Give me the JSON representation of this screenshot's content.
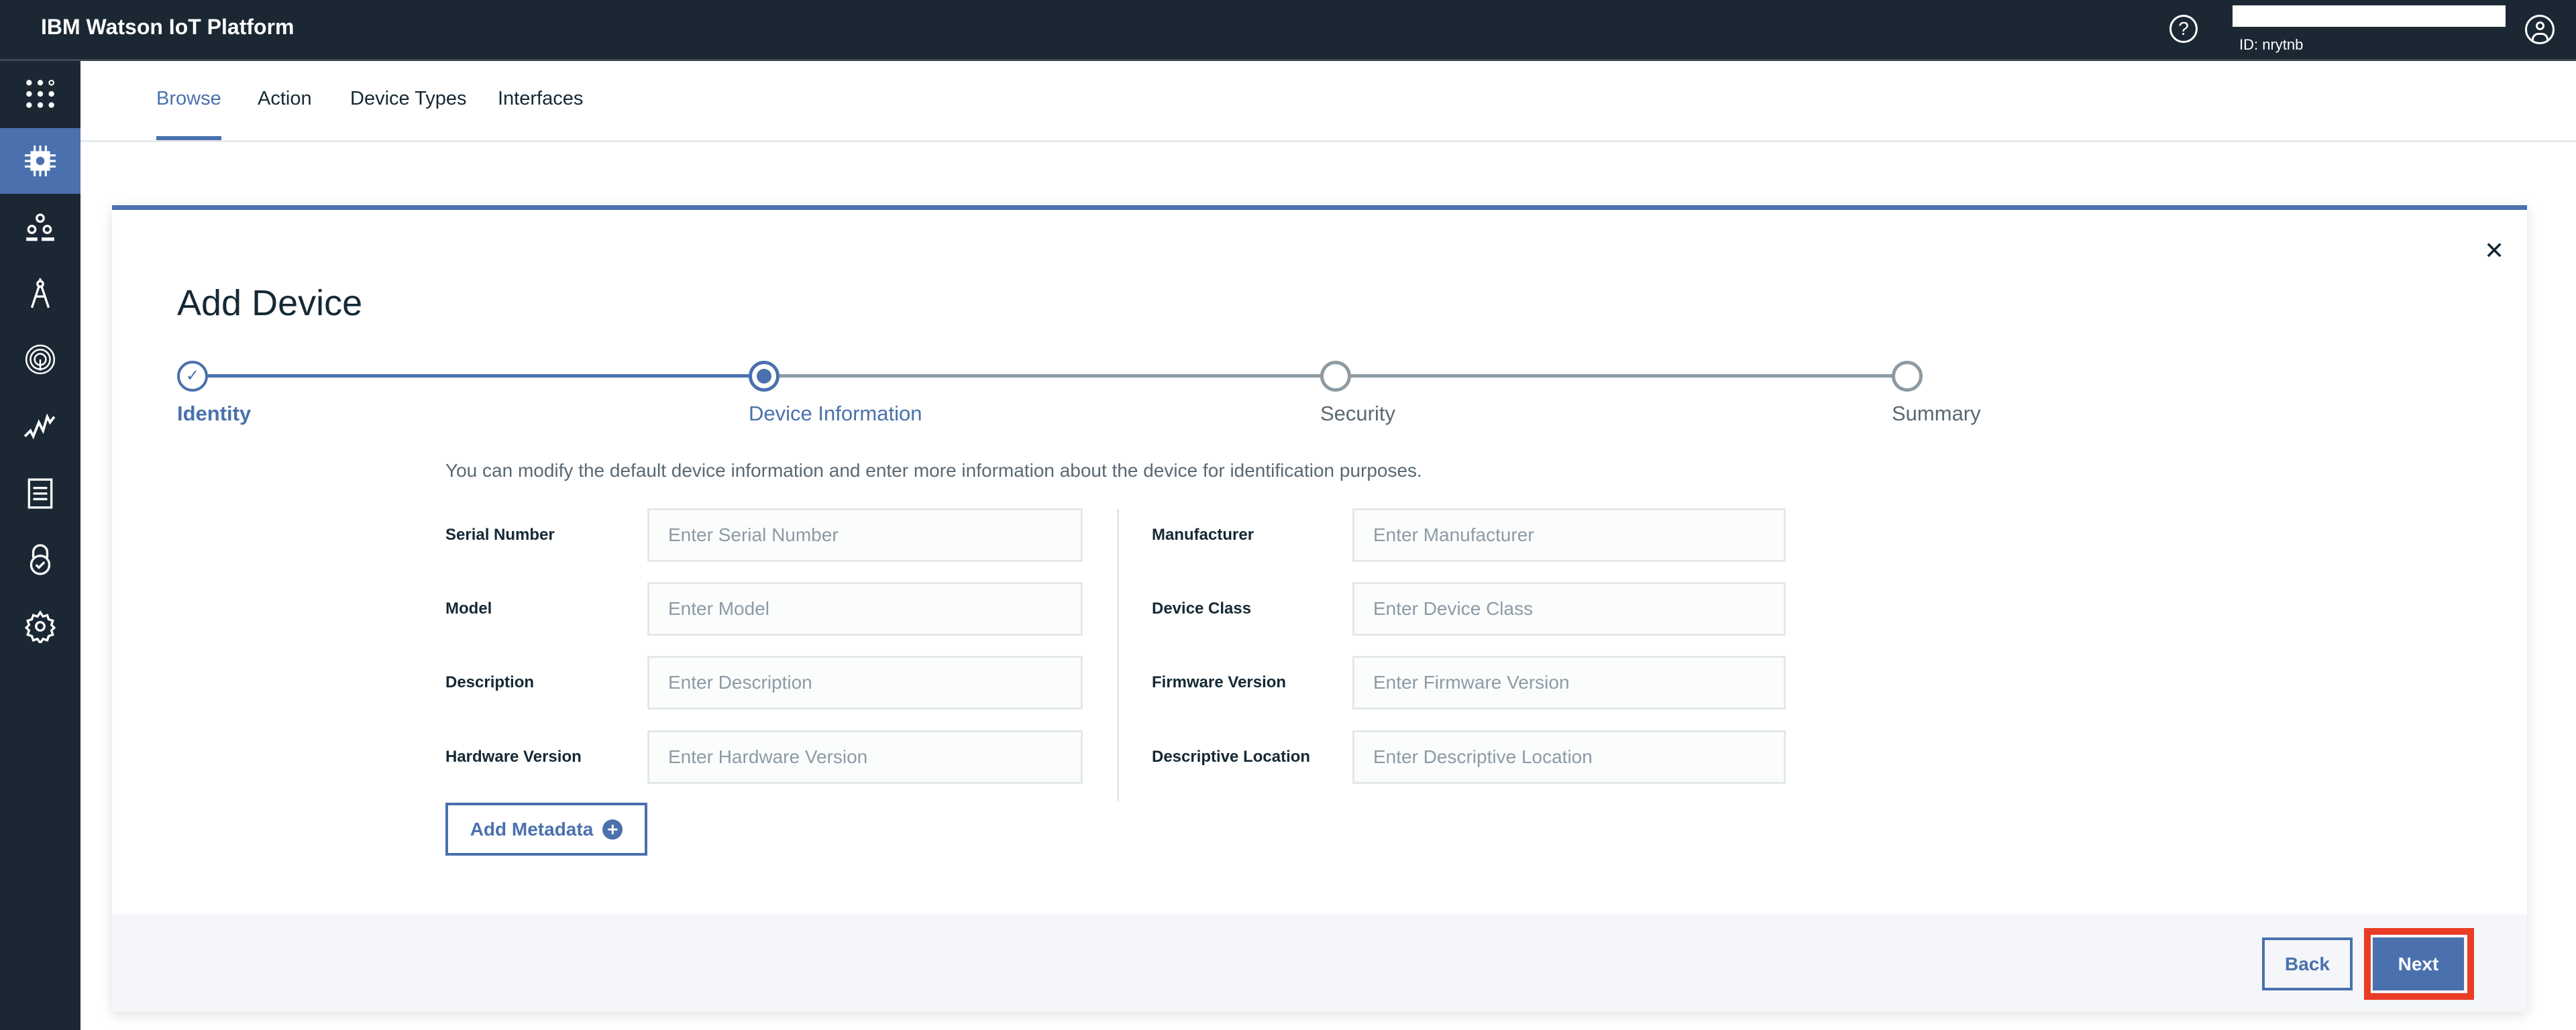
{
  "header": {
    "title": "IBM Watson IoT Platform",
    "org_id": "ID: nrytnb",
    "icons": [
      "help-icon",
      "avatar-icon"
    ]
  },
  "sidebar": {
    "items": [
      {
        "icon": "app-switcher-icon",
        "active": false
      },
      {
        "icon": "chip-icon",
        "active": true
      },
      {
        "icon": "members-icon",
        "active": false
      },
      {
        "icon": "compass-icon",
        "active": false
      },
      {
        "icon": "fingerprint-icon",
        "active": false
      },
      {
        "icon": "analytics-icon",
        "active": false
      },
      {
        "icon": "document-icon",
        "active": false
      },
      {
        "icon": "security-lock-icon",
        "active": false
      },
      {
        "icon": "settings-icon",
        "active": false
      }
    ]
  },
  "tabs": [
    {
      "label": "Browse",
      "active": true
    },
    {
      "label": "Action"
    },
    {
      "label": "Device Types"
    },
    {
      "label": "Interfaces"
    }
  ],
  "dialog": {
    "title": "Add Device",
    "steps": [
      {
        "label": "Identity",
        "state": "complete"
      },
      {
        "label": "Device Information",
        "state": "current"
      },
      {
        "label": "Security",
        "state": "pending"
      },
      {
        "label": "Summary",
        "state": "pending"
      }
    ],
    "description": "You can modify the default device information and enter more information about the device for identification purposes.",
    "left_fields": [
      {
        "label": "Serial Number",
        "placeholder": "Enter Serial Number",
        "value": ""
      },
      {
        "label": "Model",
        "placeholder": "Enter Model",
        "value": ""
      },
      {
        "label": "Description",
        "placeholder": "Enter Description",
        "value": ""
      },
      {
        "label": "Hardware Version",
        "placeholder": "Enter Hardware Version",
        "value": ""
      }
    ],
    "right_fields": [
      {
        "label": "Manufacturer",
        "placeholder": "Enter Manufacturer",
        "value": ""
      },
      {
        "label": "Device Class",
        "placeholder": "Enter Device Class",
        "value": ""
      },
      {
        "label": "Firmware Version",
        "placeholder": "Enter Firmware Version",
        "value": ""
      },
      {
        "label": "Descriptive Location",
        "placeholder": "Enter Descriptive Location",
        "value": ""
      }
    ],
    "add_metadata_label": "Add Metadata",
    "back_label": "Back",
    "next_label": "Next"
  },
  "colors": {
    "accent": "#4a71ad",
    "topbar": "#1b2834",
    "highlight": "#e93d26"
  }
}
